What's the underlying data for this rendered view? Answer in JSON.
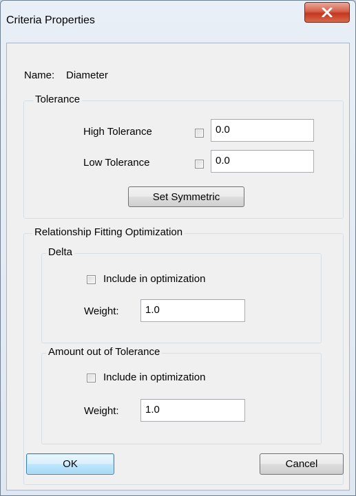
{
  "window": {
    "title": "Criteria Properties",
    "close_symbol": "X"
  },
  "name_row": {
    "label": "Name:",
    "value": "Diameter"
  },
  "tolerance": {
    "legend": "Tolerance",
    "high_label": "High Tolerance",
    "high_value": "0.0",
    "low_label": "Low Tolerance",
    "low_value": "0.0",
    "set_symmetric_label": "Set Symmetric"
  },
  "optimization": {
    "legend": "Relationship Fitting Optimization",
    "delta": {
      "legend": "Delta",
      "include_label": "Include in optimization",
      "weight_label": "Weight:",
      "weight_value": "1.0"
    },
    "amount_out": {
      "legend": "Amount out of Tolerance",
      "include_label": "Include in optimization",
      "weight_label": "Weight:",
      "weight_value": "1.0"
    }
  },
  "buttons": {
    "ok_label": "OK",
    "cancel_label": "Cancel"
  },
  "colors": {
    "close_button": "#c9462d",
    "default_button_border": "#3c7fb1",
    "dialog_face": "#f0f0f0"
  }
}
